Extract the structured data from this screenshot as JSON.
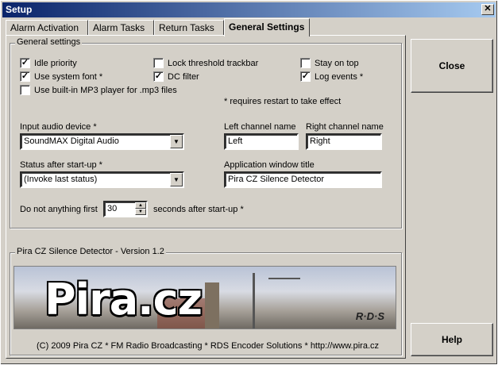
{
  "window": {
    "title": "Setup",
    "close_glyph": "✕"
  },
  "tabs": [
    {
      "label": "Alarm Activation"
    },
    {
      "label": "Alarm Tasks"
    },
    {
      "label": "Return Tasks"
    },
    {
      "label": "General Settings"
    }
  ],
  "general": {
    "legend": "General settings",
    "checkboxes": {
      "idle_priority": {
        "label": "Idle priority",
        "checked": true
      },
      "system_font": {
        "label": "Use system font *",
        "checked": true
      },
      "mp3_player": {
        "label": "Use built-in MP3 player for .mp3 files",
        "checked": false
      },
      "lock_threshold": {
        "label": "Lock threshold trackbar",
        "checked": false
      },
      "dc_filter": {
        "label": "DC filter",
        "checked": true
      },
      "stay_on_top": {
        "label": "Stay on top",
        "checked": false
      },
      "log_events": {
        "label": "Log events *",
        "checked": true
      }
    },
    "restart_note": "* requires restart to take effect",
    "input_device_label": "Input audio device *",
    "input_device_value": "SoundMAX Digital Audio",
    "left_channel_label": "Left channel name",
    "left_channel_value": "Left",
    "right_channel_label": "Right channel name",
    "right_channel_value": "Right",
    "status_label": "Status after start-up *",
    "status_value": "(Invoke last status)",
    "app_title_label": "Application window title",
    "app_title_value": "Pira CZ Silence Detector",
    "delay_prefix": "Do not anything first",
    "delay_value": "30",
    "delay_suffix": "seconds after start-up *"
  },
  "about": {
    "legend": "Pira CZ Silence Detector - Version 1.2",
    "logo": "Pira.cz",
    "rds_logo": "R·D·S",
    "copyright": "(C) 2009 Pira CZ * FM Radio Broadcasting * RDS Encoder Solutions * http://www.pira.cz"
  },
  "buttons": {
    "close": "Close",
    "help": "Help"
  },
  "icons": {
    "dropdown": "▼",
    "spin_up": "▲",
    "spin_down": "▼",
    "check": "✓"
  }
}
